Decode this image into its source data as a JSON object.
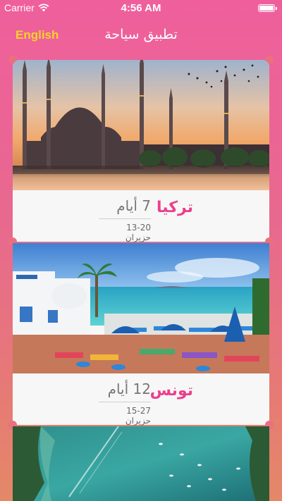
{
  "status_bar": {
    "carrier": "Carrier",
    "time": "4:56 AM"
  },
  "nav": {
    "language_button": "English",
    "title": "تطبيق سياحة"
  },
  "trips": [
    {
      "name": "تركيا",
      "duration": "7 أيام",
      "dates": "13-20 حزيران"
    },
    {
      "name": "تونس",
      "duration": "12 أيام",
      "dates": "15-27 حزيران"
    }
  ],
  "colors": {
    "accent_pink": "#ec3f8c",
    "language_yellow": "#f7d22b"
  },
  "icons": [
    "wifi-icon",
    "battery-icon"
  ]
}
